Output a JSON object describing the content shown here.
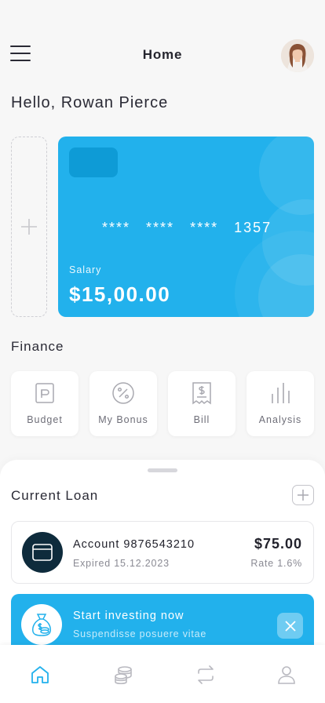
{
  "header": {
    "title": "Home",
    "menu_icon": "hamburger-menu-icon",
    "avatar_icon": "user-avatar"
  },
  "greeting": "Hello, Rowan Pierce",
  "card": {
    "number_groups": [
      "****",
      "****",
      "****",
      "1357"
    ],
    "label": "Salary",
    "amount": "$15,00.00",
    "color": "#22b1ec",
    "chip_color": "#0e9bd6"
  },
  "finance": {
    "title": "Finance",
    "items": [
      {
        "label": "Budget",
        "icon": "wallet-icon"
      },
      {
        "label": "My Bonus",
        "icon": "percent-icon"
      },
      {
        "label": "Bill",
        "icon": "receipt-icon"
      },
      {
        "label": "Analysis",
        "icon": "bar-chart-icon"
      }
    ]
  },
  "loan": {
    "title": "Current Loan",
    "account": "Account 9876543210",
    "expired": "Expired 15.12.2023",
    "amount": "$75.00",
    "rate": "Rate 1.6%"
  },
  "promo": {
    "title": "Start investing now",
    "subtitle": "Suspendisse posuere vitae"
  },
  "tabbar": {
    "items": [
      {
        "icon": "home-icon",
        "active": true
      },
      {
        "icon": "coins-icon",
        "active": false
      },
      {
        "icon": "transfer-icon",
        "active": false
      },
      {
        "icon": "profile-icon",
        "active": false
      }
    ],
    "active_color": "#22b1ec",
    "inactive_color": "#b9b9c0"
  }
}
